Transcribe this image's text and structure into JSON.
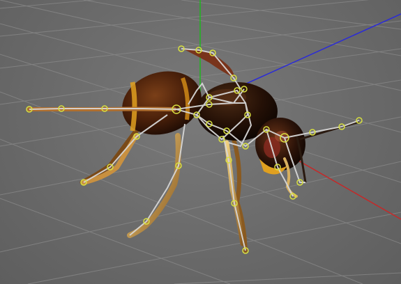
{
  "viewport": {
    "name": "3D viewport",
    "background": "#6b6b6b",
    "grid_color": "#8a8a8a"
  },
  "axes": {
    "y_axis_color": "#1fb51f",
    "z_axis_color": "#2b2bd8",
    "x_axis_color": "#c62828"
  },
  "model": {
    "subject": "wasp",
    "body_colors": {
      "abdomen": "#5a2a0e",
      "thorax": "#2a1408",
      "head": "#3a1a0a",
      "stripe": "#e0a020",
      "legs": "#d8b060"
    }
  },
  "rig": {
    "bone_color": "#d6d6d6",
    "joint_color": "#d8e040",
    "joint_count": 34
  }
}
